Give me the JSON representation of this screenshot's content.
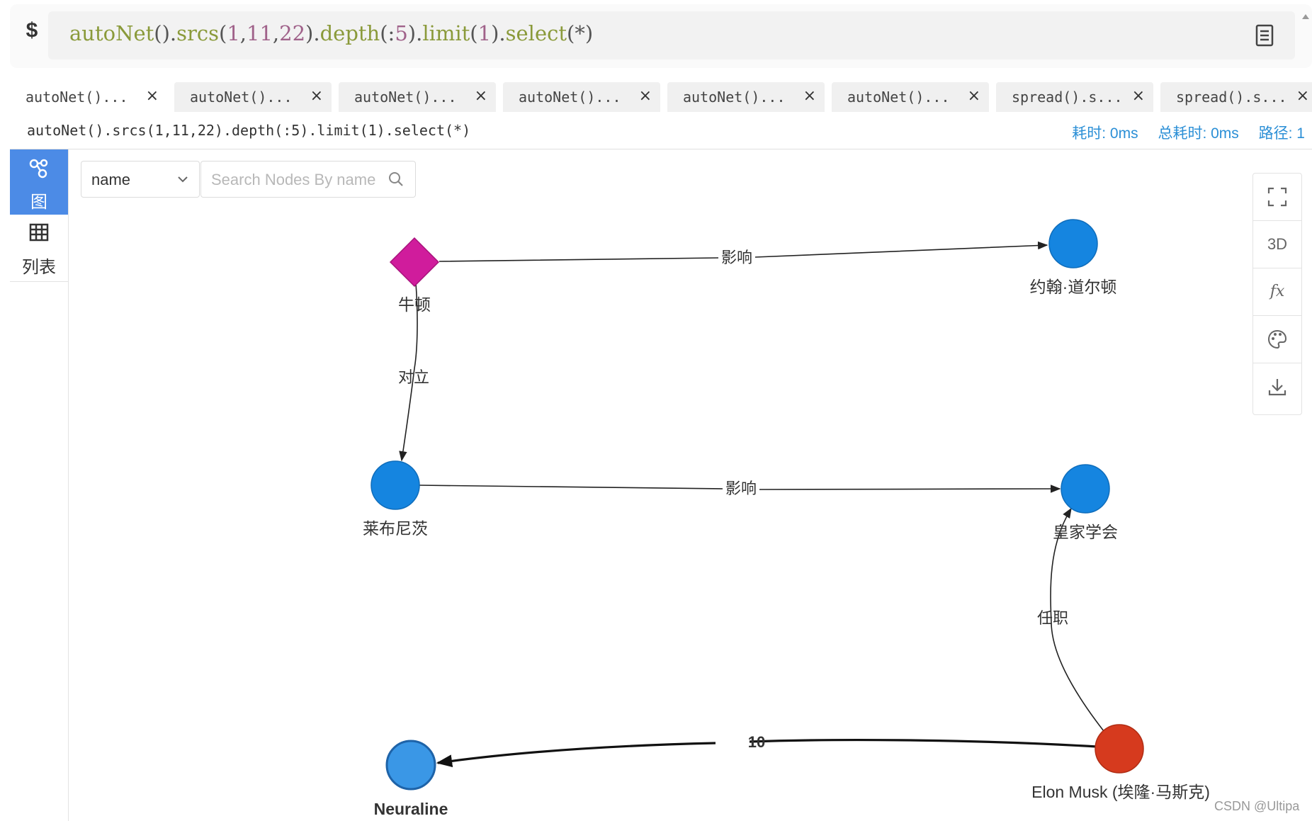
{
  "query_bar": {
    "prompt": "$",
    "query_parts": {
      "f1": "autoNet",
      "p1": "().",
      "f2": "srcs",
      "p2": "(",
      "n1": "1",
      "c1": ",",
      "n2": "11",
      "c2": ",",
      "n3": "22",
      "p3": ").",
      "f3": "depth",
      "p4": "(:",
      "n4": "5",
      "p5": ").",
      "f4": "limit",
      "p6": "(",
      "n5": "1",
      "p7": ").",
      "f5": "select",
      "p8": "(*)"
    }
  },
  "tabs": [
    {
      "label": "autoNet()...",
      "active": true
    },
    {
      "label": "autoNet()...",
      "active": false
    },
    {
      "label": "autoNet()...",
      "active": false
    },
    {
      "label": "autoNet()...",
      "active": false
    },
    {
      "label": "autoNet()...",
      "active": false
    },
    {
      "label": "autoNet()...",
      "active": false
    },
    {
      "label": "spread().s...",
      "active": false
    },
    {
      "label": "spread().s...",
      "active": false
    }
  ],
  "tab_close": "×",
  "info": {
    "query": "autoNet().srcs(1,11,22).depth(:5).limit(1).select(*)",
    "time": "耗时: 0ms",
    "total_time": "总耗时: 0ms",
    "paths": "路径: 1"
  },
  "side_nav": {
    "graph_label": "图",
    "list_label": "列表"
  },
  "search": {
    "field": "name",
    "placeholder": "Search Nodes By name"
  },
  "toolbar": {
    "three_d": "3D",
    "fx": "fx"
  },
  "graph": {
    "nodes": [
      {
        "id": "newton",
        "label": "牛顿",
        "shape": "diamond",
        "color": "#d01c9c"
      },
      {
        "id": "dalton",
        "label": "约翰·道尔顿",
        "shape": "circle",
        "color": "#1585e0"
      },
      {
        "id": "leibniz",
        "label": "莱布尼茨",
        "shape": "circle",
        "color": "#1585e0"
      },
      {
        "id": "royal",
        "label": "皇家学会",
        "shape": "circle",
        "color": "#1585e0"
      },
      {
        "id": "musk",
        "label": "Elon Musk (埃隆·马斯克)",
        "shape": "circle",
        "color": "#d63a1e"
      },
      {
        "id": "neuraline",
        "label": "Neuraline",
        "shape": "circle",
        "color": "#3a97e6"
      }
    ],
    "edges": [
      {
        "from": "newton",
        "to": "dalton",
        "label": "影响"
      },
      {
        "from": "newton",
        "to": "leibniz",
        "label": "对立"
      },
      {
        "from": "leibniz",
        "to": "royal",
        "label": "影响"
      },
      {
        "from": "musk",
        "to": "royal",
        "label": "任职"
      },
      {
        "from": "musk",
        "to": "neuraline",
        "label": "10"
      }
    ]
  },
  "watermark": "CSDN @Ultipa"
}
